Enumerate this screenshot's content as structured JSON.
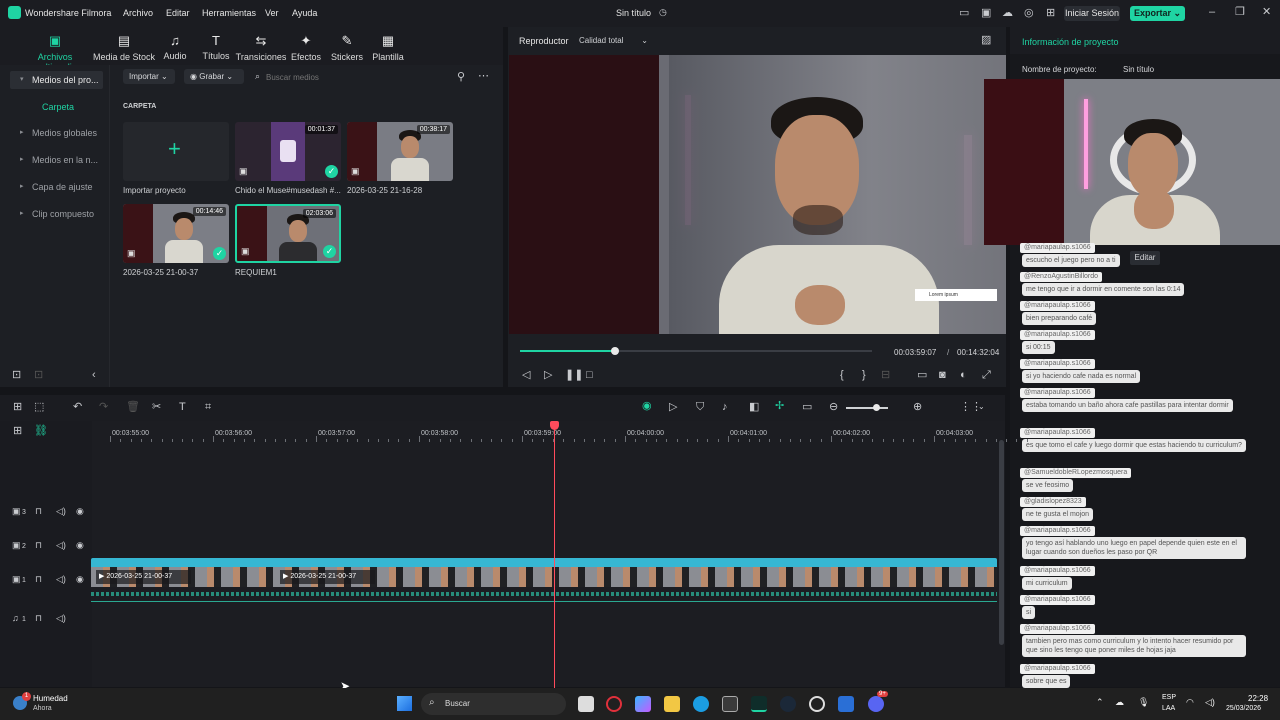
{
  "app": {
    "name": "Wondershare Filmora",
    "menu": [
      "Archivo",
      "Editar",
      "Herramientas",
      "Ver",
      "Ayuda"
    ],
    "project_title": "Sin título",
    "login_label": "Iniciar Sesión",
    "export_label": "Exportar"
  },
  "toolbar": {
    "items": [
      {
        "label": "Archivos multimedia",
        "icon": "media-icon"
      },
      {
        "label": "Media de Stock",
        "icon": "stock-icon"
      },
      {
        "label": "Audio",
        "icon": "audio-icon"
      },
      {
        "label": "Títulos",
        "icon": "titles-icon"
      },
      {
        "label": "Transiciones",
        "icon": "transitions-icon"
      },
      {
        "label": "Efectos",
        "icon": "effects-icon"
      },
      {
        "label": "Stickers",
        "icon": "stickers-icon"
      },
      {
        "label": "Plantilla",
        "icon": "template-icon"
      }
    ]
  },
  "media": {
    "import_label": "Importar",
    "record_label": "Grabar",
    "search_placeholder": "Buscar medios",
    "folder_label": "CARPETA",
    "sidebar": [
      "Medios del pro...",
      "Carpeta",
      "Medios globales",
      "Medios en la n...",
      "Capa de ajuste",
      "Clip compuesto"
    ],
    "items": [
      {
        "label": "Importar proyecto",
        "duration": ""
      },
      {
        "label": "Chido el Muse#musedash #...",
        "duration": "00:01:37"
      },
      {
        "label": "2026-03-25 21-16-28",
        "duration": "00:38:17"
      },
      {
        "label": "2026-03-25 21-00-37",
        "duration": "00:14:46"
      },
      {
        "label": "REQUIEM1",
        "duration": "02:03:06"
      }
    ]
  },
  "player": {
    "tab_label": "Reproductor",
    "quality_label": "Calidad total",
    "current_time": "00:03:59:07",
    "total_time": "00:14:32:04",
    "progress": 0.27,
    "overlay_text": "Lorem ipsum"
  },
  "project_info": {
    "title": "Información de proyecto",
    "name_label": "Nombre de proyecto:",
    "name_value": "Sin título",
    "edit_label": "Editar"
  },
  "chat": [
    {
      "user": "@mariapaulap.s1066",
      "msg": "escucho el juego pero no a ti"
    },
    {
      "user": "@RenzoAgustinBillordo",
      "msg": "me tengo que ir a dormir en comente son las 0:14"
    },
    {
      "user": "@mariapaulap.s1066",
      "msg": "bien preparando café"
    },
    {
      "user": "@mariapaulap.s1066",
      "msg": "si 00:15"
    },
    {
      "user": "@mariapaulap.s1066",
      "msg": "si yo haciendo cafe nada es normal"
    },
    {
      "user": "@mariapaulap.s1066",
      "msg": "estaba tomando un baño ahora cafe pastillas para intentar dormir"
    },
    {
      "user": "@mariapaulap.s1066",
      "msg": "es que tomo el cafe y luego dormir que estas haciendo tu curriculum?"
    },
    {
      "user": "@SamueldobleRLopezmosquera",
      "msg": "se ve feosimo"
    },
    {
      "user": "@gladislopez8323",
      "msg": "ne te gusta el mojon"
    },
    {
      "user": "@mariapaulap.s1066",
      "msg": "yo tengo así hablando uno luego en papel depende quien este en el lugar cuando son dueños les paso por QR"
    },
    {
      "user": "@mariapaulap.s1066",
      "msg": "mi curriculum"
    },
    {
      "user": "@mariapaulap.s1066",
      "msg": "si"
    },
    {
      "user": "@mariapaulap.s1066",
      "msg": "tambien pero mas como curriculum y lo intento hacer resumido por que sino les tengo que poner miles de hojas jaja"
    },
    {
      "user": "@mariapaulap.s1066",
      "msg": "sobre que es"
    }
  ],
  "timeline": {
    "ticks": [
      "00:03:55:00",
      "00:03:56:00",
      "00:03:57:00",
      "00:03:58:00",
      "00:03:59:00",
      "00:04:00:00",
      "00:04:01:00",
      "00:04:02:00",
      "00:04:03:00"
    ],
    "tracks": [
      "3",
      "2",
      "1",
      "1"
    ],
    "clips": [
      "2026-03-25 21-00-37",
      "2026-03-25 21-00-37"
    ],
    "zoom": 0.65
  },
  "taskbar": {
    "weather_label": "Humedad",
    "weather_sub": "Ahora",
    "search_label": "Buscar",
    "lang": "ESP",
    "lang_sub": "LAA",
    "time": "22:28",
    "date": "25/03/2026",
    "badge": "9+",
    "weather_badge": "1"
  },
  "colors": {
    "accent": "#1fd4a3",
    "playhead": "#ff4b5c",
    "clip": "#36b7d3"
  }
}
